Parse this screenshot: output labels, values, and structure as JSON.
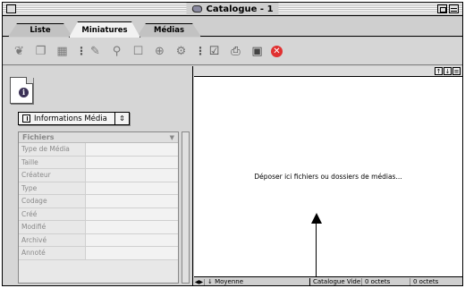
{
  "window": {
    "title": "Catalogue - 1"
  },
  "tabs": [
    {
      "label": "Liste"
    },
    {
      "label": "Miniatures"
    },
    {
      "label": "Médias"
    }
  ],
  "toolbar": {
    "icons": [
      "new-catalogue-icon",
      "copy-icon",
      "trash-icon",
      "edit-icon",
      "search-icon",
      "magnify-icon",
      "zoom-icon",
      "tool-icon",
      "checkbox-icon",
      "print-icon",
      "folder-icon",
      "stop-icon"
    ]
  },
  "left_panel": {
    "popup_label": "Informations Média",
    "properties_header": "Fichiers",
    "properties": [
      {
        "key": "Type de Média"
      },
      {
        "key": "Taille"
      },
      {
        "key": "Créateur"
      },
      {
        "key": "Type"
      },
      {
        "key": "Codage"
      },
      {
        "key": "Créé"
      },
      {
        "key": "Modifié"
      },
      {
        "key": "Archivé"
      },
      {
        "key": "Annoté"
      }
    ]
  },
  "drop_area": {
    "text": "Déposer ici fichiers ou dossiers de médias..."
  },
  "status_bar": {
    "view": "Moyenne",
    "catalogue": "Catalogue Vide",
    "size1": "0 octets",
    "size2": "0 octets"
  }
}
